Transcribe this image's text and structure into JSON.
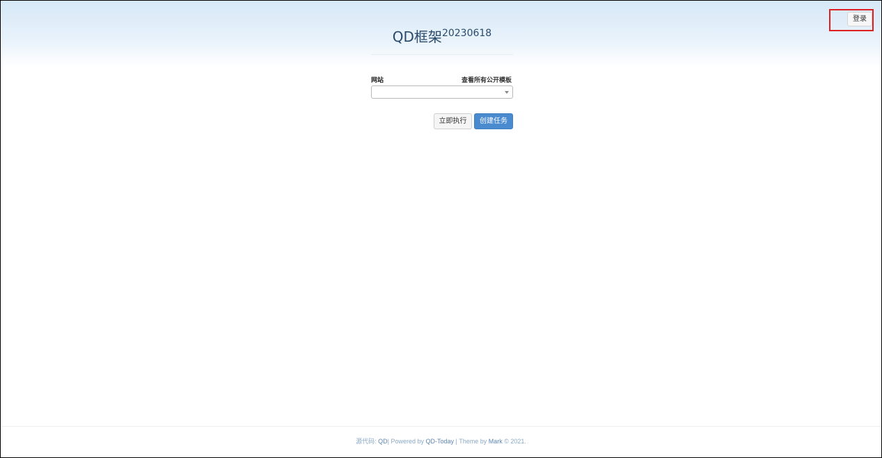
{
  "header": {
    "login_label": "登录",
    "title": "QD框架",
    "version": "20230618"
  },
  "form": {
    "site_label": "网站",
    "templates_link": "查看所有公开模板",
    "site_value": "",
    "run_now_label": "立即执行",
    "create_task_label": "创建任务"
  },
  "footer": {
    "source_prefix": "源代码: ",
    "source_link": "QD",
    "powered_prefix": "| Powered by ",
    "powered_link": "QD-Today",
    "theme_prefix": " | Theme by ",
    "theme_link": "Mark",
    "copyright": " © 2021."
  },
  "colors": {
    "primary": "#4a8bd0",
    "title": "#2a4a6b",
    "highlight_box": "#e02020"
  }
}
